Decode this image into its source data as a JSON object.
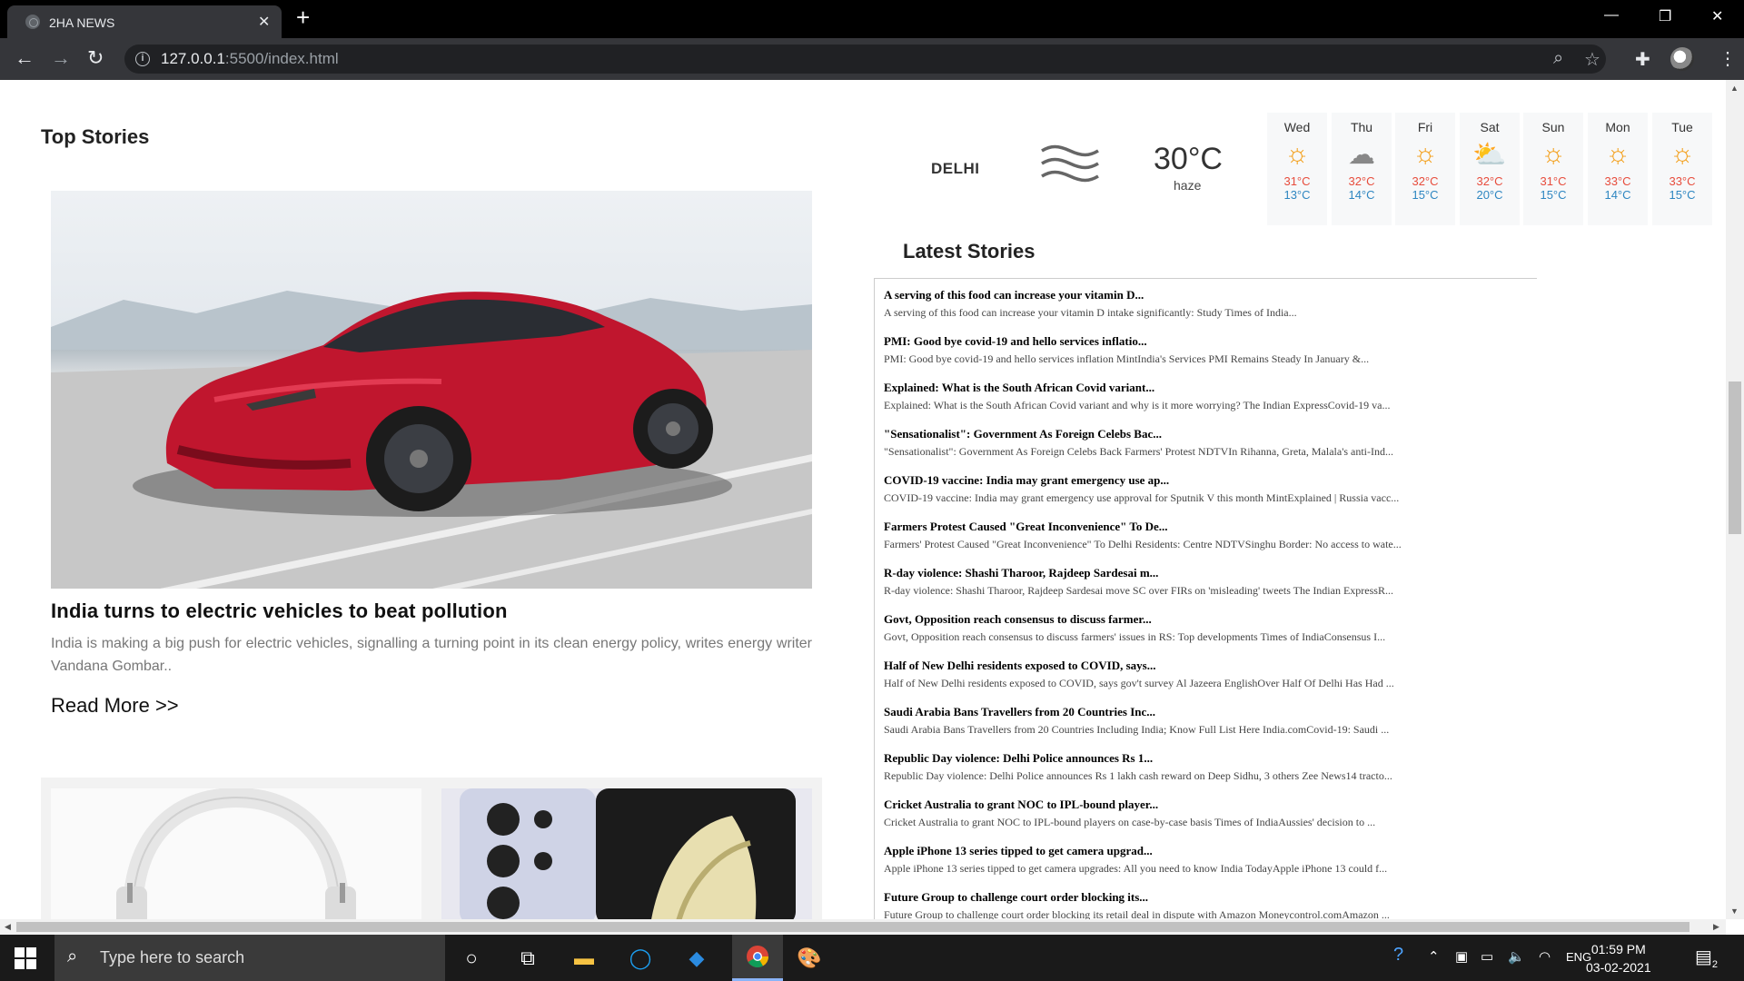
{
  "browser": {
    "tab_title": "2HA NEWS",
    "tab_close": "✕",
    "new_tab": "+",
    "url_host": "127.0.0.1",
    "url_rest": ":5500/index.html",
    "window_controls": {
      "minimize": "—",
      "maximize": "❐",
      "close": "✕"
    }
  },
  "page": {
    "top_stories_heading": "Top Stories",
    "hero": {
      "title": "India turns to electric vehicles to beat pollution",
      "description": "India is making a big push for electric vehicles, signalling a turning point in its clean energy policy, writes energy writer Vandana Gombar..",
      "read_more": "Read More >>"
    },
    "weather": {
      "city": "DELHI",
      "temperature": "30°C",
      "condition": "haze",
      "forecast": [
        {
          "day": "Wed",
          "icon": "sun-icon",
          "high": "31°C",
          "low": "13°C"
        },
        {
          "day": "Thu",
          "icon": "cloud-icon",
          "high": "32°C",
          "low": "14°C"
        },
        {
          "day": "Fri",
          "icon": "sun-icon",
          "high": "32°C",
          "low": "15°C"
        },
        {
          "day": "Sat",
          "icon": "partly-cloudy-icon",
          "high": "32°C",
          "low": "20°C"
        },
        {
          "day": "Sun",
          "icon": "sun-icon",
          "high": "31°C",
          "low": "15°C"
        },
        {
          "day": "Mon",
          "icon": "sun-icon",
          "high": "33°C",
          "low": "14°C"
        },
        {
          "day": "Tue",
          "icon": "sun-icon",
          "high": "33°C",
          "low": "15°C"
        }
      ]
    },
    "latest_heading": "Latest Stories",
    "latest": [
      {
        "headline": "A serving of this food can increase your vitamin D...",
        "summary": "A serving of this food can increase your vitamin D intake significantly: Study  Times of India..."
      },
      {
        "headline": "PMI: Good bye covid-19 and hello services inflatio...",
        "summary": "PMI: Good bye covid-19 and hello services inflation  MintIndia's Services PMI Remains Steady In January &..."
      },
      {
        "headline": "Explained: What is the South African Covid variant...",
        "summary": "Explained: What is the South African Covid variant and why is it more worrying?  The Indian ExpressCovid-19 va..."
      },
      {
        "headline": "\"Sensationalist\": Government As Foreign Celebs Bac...",
        "summary": "\"Sensationalist\": Government As Foreign Celebs Back Farmers' Protest  NDTVIn Rihanna, Greta, Malala's anti-Ind..."
      },
      {
        "headline": "COVID-19 vaccine: India may grant emergency use ap...",
        "summary": "COVID-19 vaccine: India may grant emergency use approval for Sputnik V this month  MintExplained | Russia vacc..."
      },
      {
        "headline": "Farmers Protest Caused \"Great Inconvenience\" To De...",
        "summary": "Farmers' Protest Caused \"Great Inconvenience\" To Delhi Residents: Centre  NDTVSinghu Border: No access to wate..."
      },
      {
        "headline": "R-day violence: Shashi Tharoor, Rajdeep Sardesai m...",
        "summary": "R-day violence: Shashi Tharoor, Rajdeep Sardesai move SC over FIRs on 'misleading' tweets  The Indian ExpressR..."
      },
      {
        "headline": "Govt, Opposition reach consensus to discuss farmer...",
        "summary": "Govt, Opposition reach consensus to discuss farmers' issues in RS: Top developments  Times of IndiaConsensus I..."
      },
      {
        "headline": "Half of New Delhi residents exposed to COVID, says...",
        "summary": "Half of New Delhi residents exposed to COVID, says gov't survey  Al Jazeera EnglishOver Half Of Delhi Has Had ..."
      },
      {
        "headline": "Saudi Arabia Bans Travellers from 20 Countries Inc...",
        "summary": "Saudi Arabia Bans Travellers from 20 Countries Including India; Know Full List Here  India.comCovid-19: Saudi ..."
      },
      {
        "headline": "Republic Day violence: Delhi Police announces Rs 1...",
        "summary": "Republic Day violence: Delhi Police announces Rs 1 lakh cash reward on Deep Sidhu, 3 others  Zee News14 tracto..."
      },
      {
        "headline": "Cricket Australia to grant NOC to IPL-bound player...",
        "summary": "Cricket Australia to grant NOC to IPL-bound players on case-by-case basis  Times of IndiaAussies' decision to ..."
      },
      {
        "headline": "Apple iPhone 13 series tipped to get camera upgrad...",
        "summary": "Apple iPhone 13 series tipped to get camera upgrades: All you need to know  India TodayApple iPhone 13 could f..."
      },
      {
        "headline": "Future Group to challenge court order blocking its...",
        "summary": "Future Group to challenge court order blocking its retail deal in dispute with Amazon  Moneycontrol.comAmazon ..."
      }
    ]
  },
  "taskbar": {
    "search_placeholder": "Type here to search",
    "language": "ENG",
    "time": "01:59 PM",
    "date": "03-02-2021",
    "notification_count": "2"
  }
}
